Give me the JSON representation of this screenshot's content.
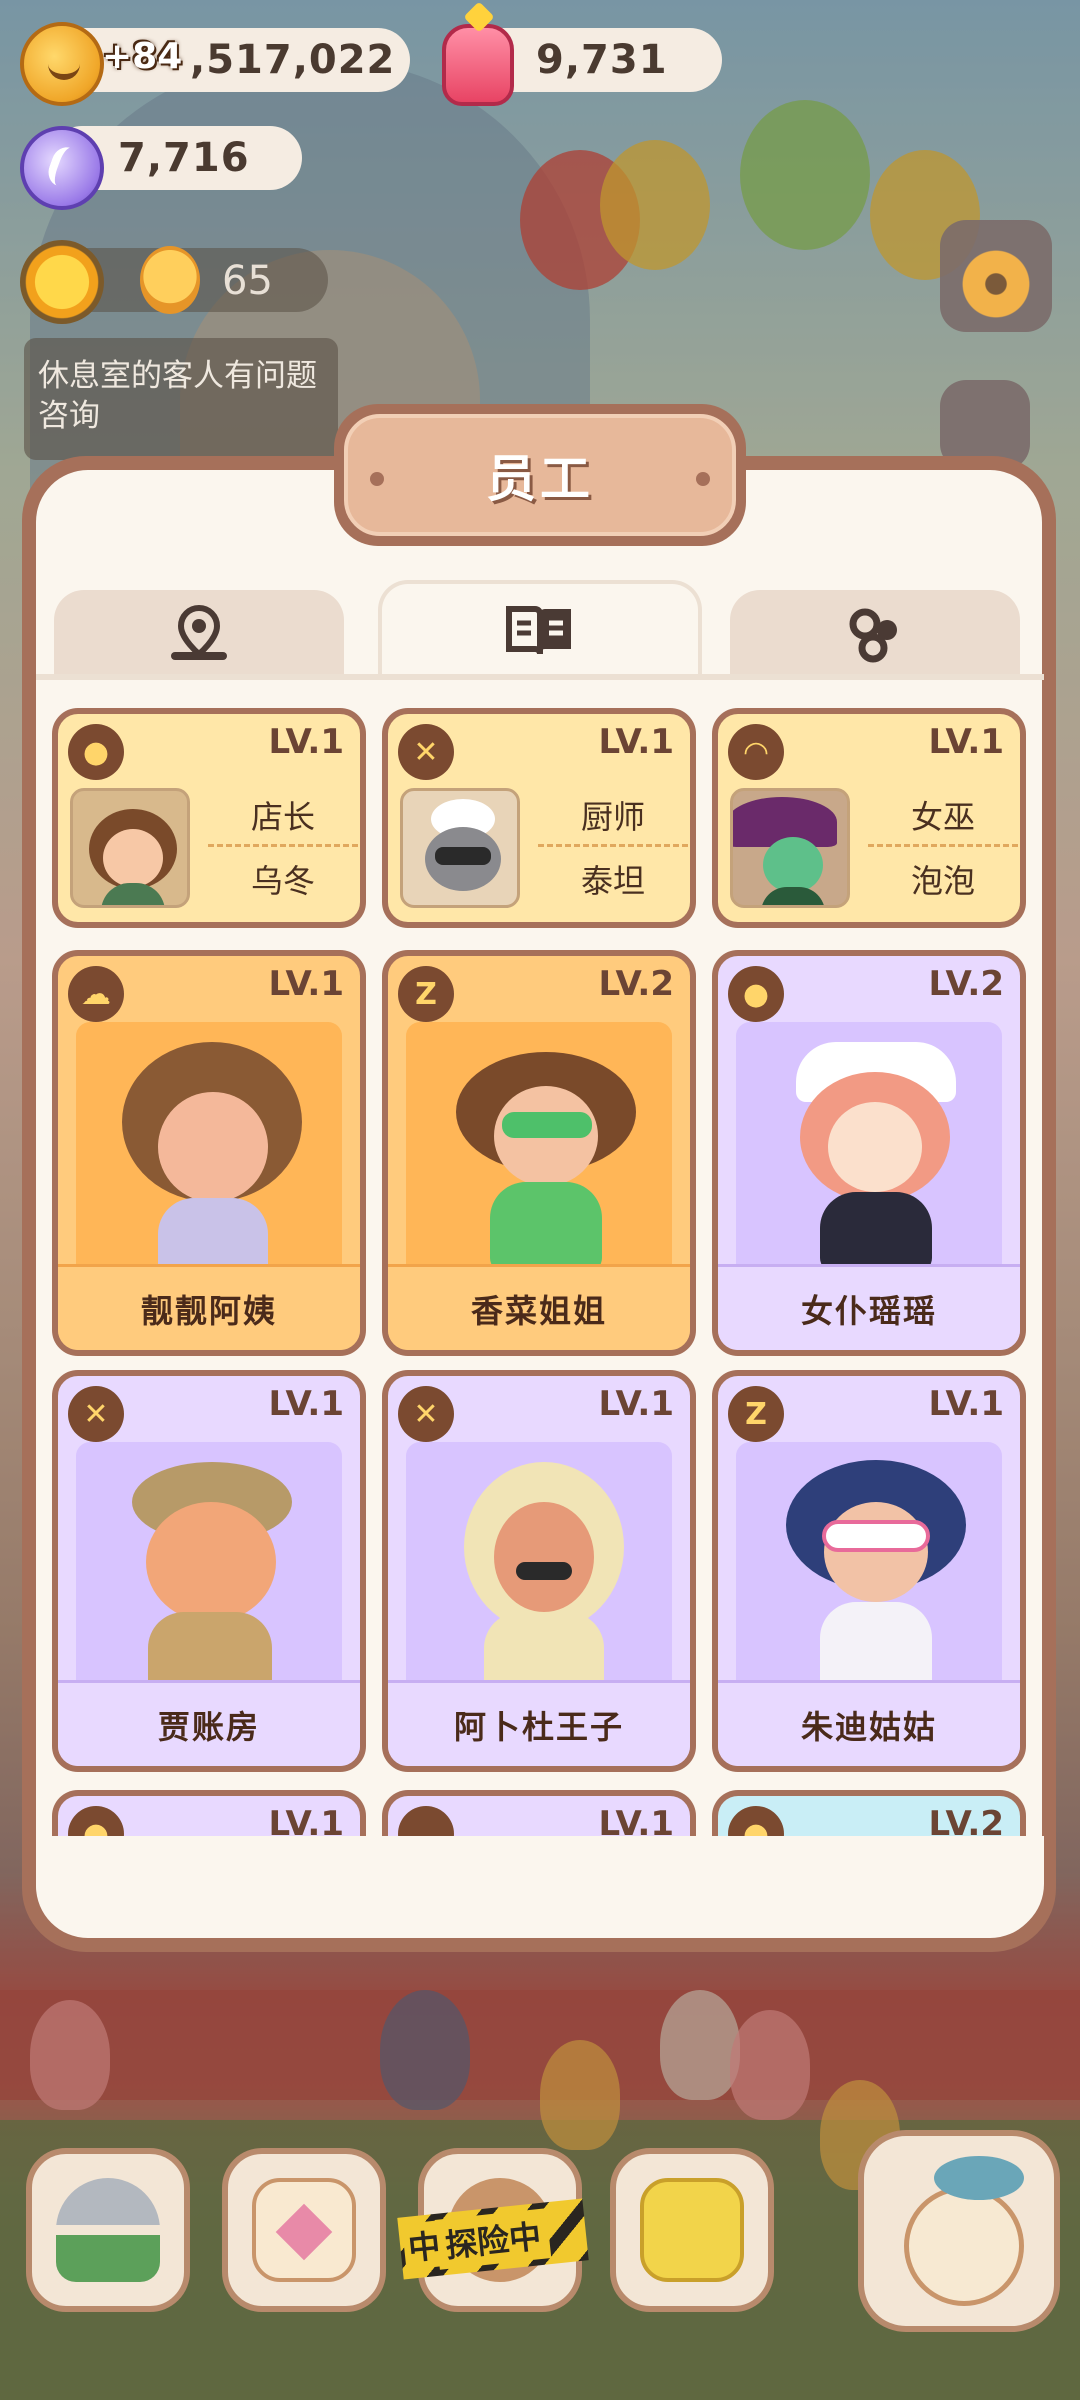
{
  "hud": {
    "coins": "+84",
    "coins_value": ",517,022",
    "jelly": "9,731",
    "gems": "7,716",
    "level": "65",
    "notice": "休息室的客人有问题咨询"
  },
  "panel": {
    "title": "员工",
    "tabs": [
      {
        "icon": "location-icon",
        "active": false
      },
      {
        "icon": "book-icon",
        "active": true
      },
      {
        "icon": "paw-icon",
        "active": false
      }
    ]
  },
  "featured": [
    {
      "icon": "cookie-icon",
      "level": "LV.1",
      "role": "店长",
      "name": "乌冬"
    },
    {
      "icon": "fork-knife-icon",
      "level": "LV.1",
      "role": "厨师",
      "name": "泰坦"
    },
    {
      "icon": "cauldron-icon",
      "level": "LV.1",
      "role": "女巫",
      "name": "泡泡"
    }
  ],
  "staff": [
    {
      "icon": "cloud-icon",
      "level": "LV.1",
      "name": "靓靓阿姨",
      "color": "orange"
    },
    {
      "icon": "sleep-icon",
      "level": "LV.2",
      "name": "香菜姐姐",
      "color": "orange"
    },
    {
      "icon": "cookie-icon",
      "level": "LV.2",
      "name": "女仆瑶瑶",
      "color": "purple"
    },
    {
      "icon": "fork-knife-icon",
      "level": "LV.1",
      "name": "贾账房",
      "color": "purple"
    },
    {
      "icon": "fork-knife-icon",
      "level": "LV.1",
      "name": "阿卜杜王子",
      "color": "purple"
    },
    {
      "icon": "sleep-icon",
      "level": "LV.1",
      "name": "朱迪姑姑",
      "color": "purple"
    },
    {
      "icon": "cookie-icon",
      "level": "LV.1",
      "name": "",
      "color": "purple"
    },
    {
      "icon": "blank-icon",
      "level": "LV.1",
      "name": "",
      "color": "purple"
    },
    {
      "icon": "cookie-icon",
      "level": "LV.2",
      "name": "",
      "color": "cyan"
    }
  ],
  "bottom": {
    "adventure_label": "探险中",
    "adventure_prefix": "中"
  }
}
